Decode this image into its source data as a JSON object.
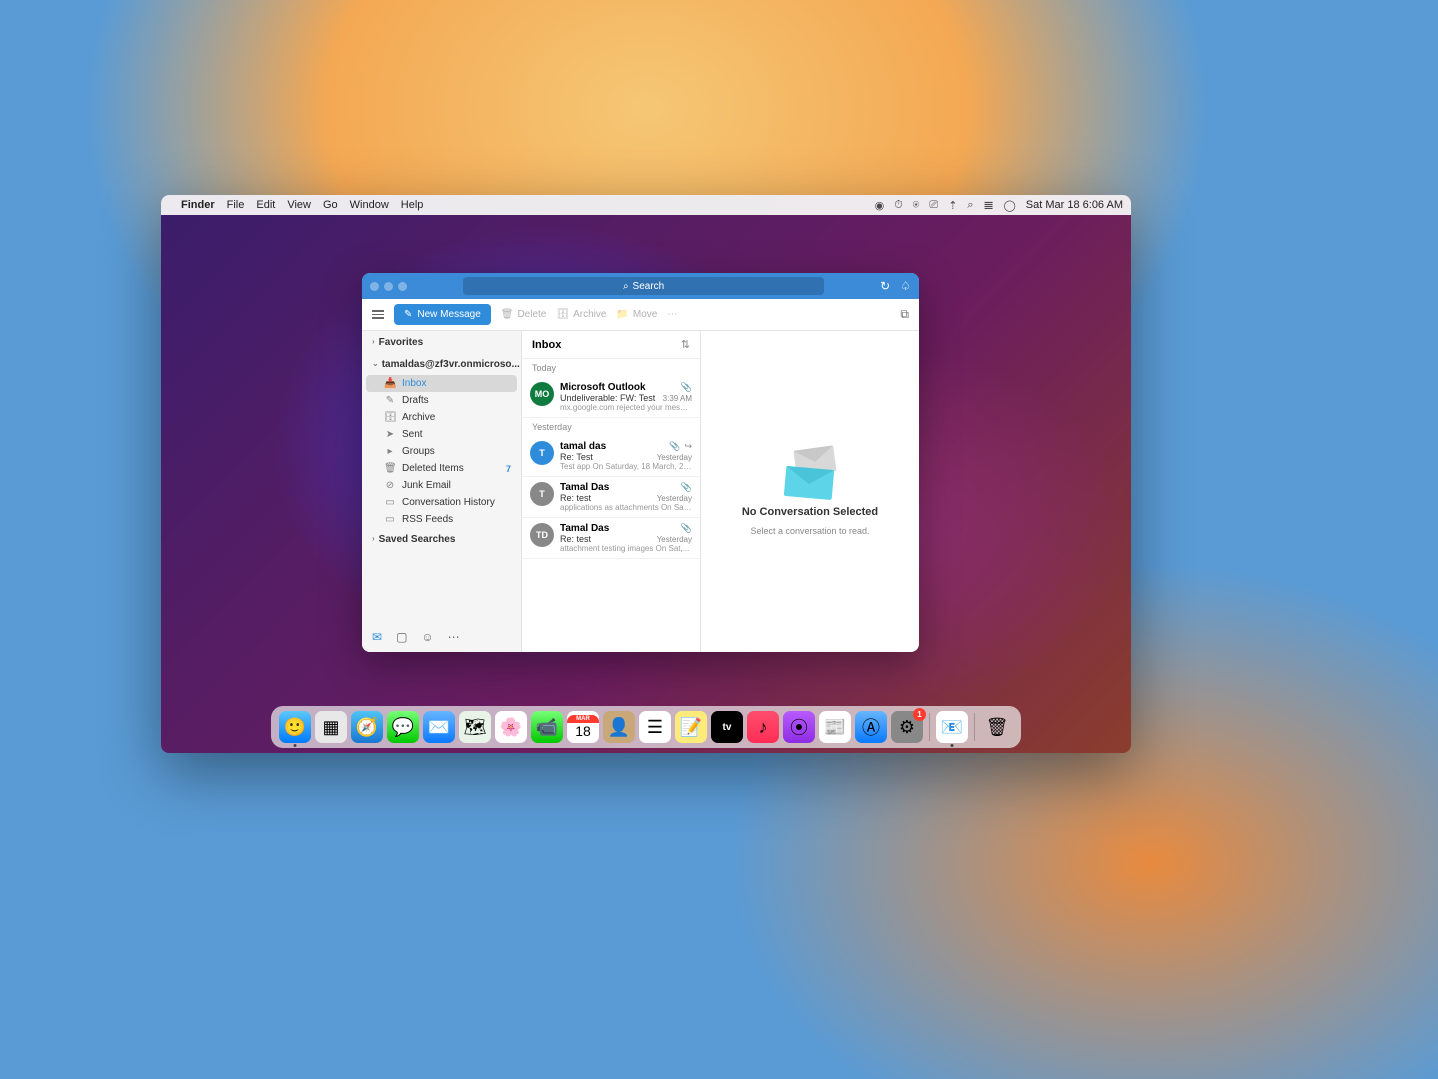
{
  "menubar": {
    "app": "Finder",
    "items": [
      "File",
      "Edit",
      "View",
      "Go",
      "Window",
      "Help"
    ],
    "datetime": "Sat Mar 18  6:06 AM"
  },
  "outlook": {
    "search_placeholder": "Search",
    "toolbar": {
      "new_msg": "New Message",
      "delete": "Delete",
      "archive": "Archive",
      "move": "Move"
    },
    "sidebar": {
      "favorites": "Favorites",
      "account": "tamaldas@zf3vr.onmicroso...",
      "folders": [
        {
          "icon": "📥",
          "label": "Inbox",
          "active": true
        },
        {
          "icon": "✎",
          "label": "Drafts"
        },
        {
          "icon": "🗄",
          "label": "Archive"
        },
        {
          "icon": "➤",
          "label": "Sent"
        },
        {
          "icon": "▸",
          "label": "Groups",
          "chev": true
        },
        {
          "icon": "🗑",
          "label": "Deleted Items",
          "count": "7"
        },
        {
          "icon": "⊘",
          "label": "Junk Email"
        },
        {
          "icon": "▭",
          "label": "Conversation History"
        },
        {
          "icon": "▭",
          "label": "RSS Feeds"
        }
      ],
      "saved": "Saved Searches"
    },
    "msglist": {
      "title": "Inbox",
      "groups": [
        {
          "label": "Today",
          "items": [
            {
              "avatar": "MO",
              "color": "#0f7b3e",
              "sender": "Microsoft Outlook",
              "subject": "Undeliverable: FW: Test",
              "time": "3:39 AM",
              "preview": "mx.google.com rejected your messa...",
              "attach": true
            }
          ]
        },
        {
          "label": "Yesterday",
          "items": [
            {
              "avatar": "T",
              "color": "#2e8cdb",
              "sender": "tamal das",
              "subject": "Re: Test",
              "time": "Yesterday",
              "preview": "Test app On Saturday, 18 March, 20...",
              "attach": true,
              "forward": true
            },
            {
              "avatar": "T",
              "color": "#888",
              "sender": "Tamal Das",
              "subject": "Re: test",
              "time": "Yesterday",
              "preview": "applications as attachments On Sat,...",
              "attach": true
            },
            {
              "avatar": "TD",
              "color": "#888",
              "sender": "Tamal Das",
              "subject": "Re: test",
              "time": "Yesterday",
              "preview": "attachment testing images On Sat,...",
              "attach": true
            }
          ]
        }
      ]
    },
    "reading": {
      "title": "No Conversation Selected",
      "subtitle": "Select a conversation to read."
    }
  },
  "dock": {
    "calendar": {
      "month": "MAR",
      "day": "18"
    },
    "tv": "tv",
    "settings_badge": "1"
  }
}
